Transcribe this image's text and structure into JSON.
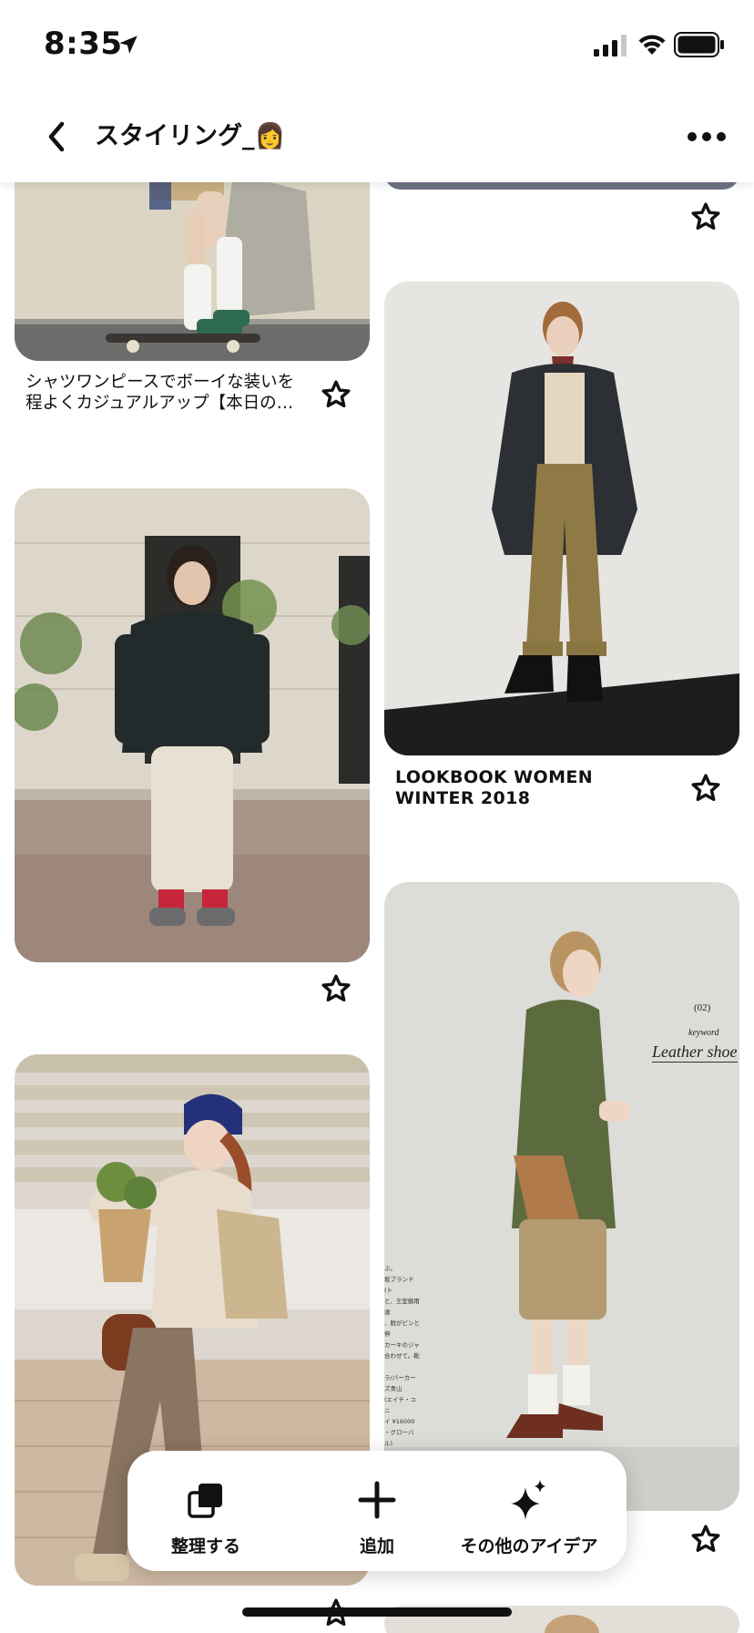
{
  "status_bar": {
    "time": "8:35",
    "icons": [
      "location-arrow-icon",
      "signal-icon",
      "wifi-icon",
      "battery-icon"
    ]
  },
  "header": {
    "back_icon": "chevron-left-icon",
    "title": "スタイリング_👩",
    "more_icon": "more-horizontal-icon"
  },
  "pins": [
    {
      "id": "skateboard-outfit",
      "title": "シャツワンピースでボーイな装いを 程よくカジュアルアップ【本日の…",
      "action_icon": "star-outline-icon"
    },
    {
      "id": "navy-jacket-street",
      "title": "",
      "action_icon": "star-outline-icon"
    },
    {
      "id": "beanie-basket-walk",
      "title": "",
      "action_icon": "star-outline-icon"
    },
    {
      "id": "top-right-partial",
      "title": "",
      "action_icon": "star-outline-icon"
    },
    {
      "id": "lookbook-tweed-coat",
      "title": "LOOKBOOK WOMEN WINTER 2018",
      "action_icon": "star-outline-icon"
    },
    {
      "id": "khaki-jacket-magazine",
      "title": "",
      "action_icon": "star-outline-icon"
    },
    {
      "id": "bottom-right-partial",
      "title": "",
      "action_icon": "star-outline-icon"
    }
  ],
  "magazine_overlay": {
    "number": "(02)",
    "keyword": "keyword",
    "headline": "Leather shoe",
    "caption": [
      "ぶ。",
      "坂ブランド(ト",
      "と、王室御用達",
      "、脱がピンと伸",
      "カーキのジャ",
      "合わせて。靴",
      "",
      "ラ/パーカーズ青山",
      "(エイチ・ユニ",
      "イ ¥16000",
      "・グローバル)",
      "NTADE(プリ",
      "ン(フィート"
    ]
  },
  "action_bar": {
    "organize": {
      "label": "整理する",
      "icon": "organize-icon"
    },
    "add": {
      "label": "追加",
      "icon": "plus-icon"
    },
    "more_ideas": {
      "label": "その他のアイデア",
      "icon": "sparkle-icon"
    }
  },
  "colors": {
    "background": "#ffffff",
    "text": "#111111",
    "action_bar_shadow": "rgba(0,0,0,0.18)"
  }
}
